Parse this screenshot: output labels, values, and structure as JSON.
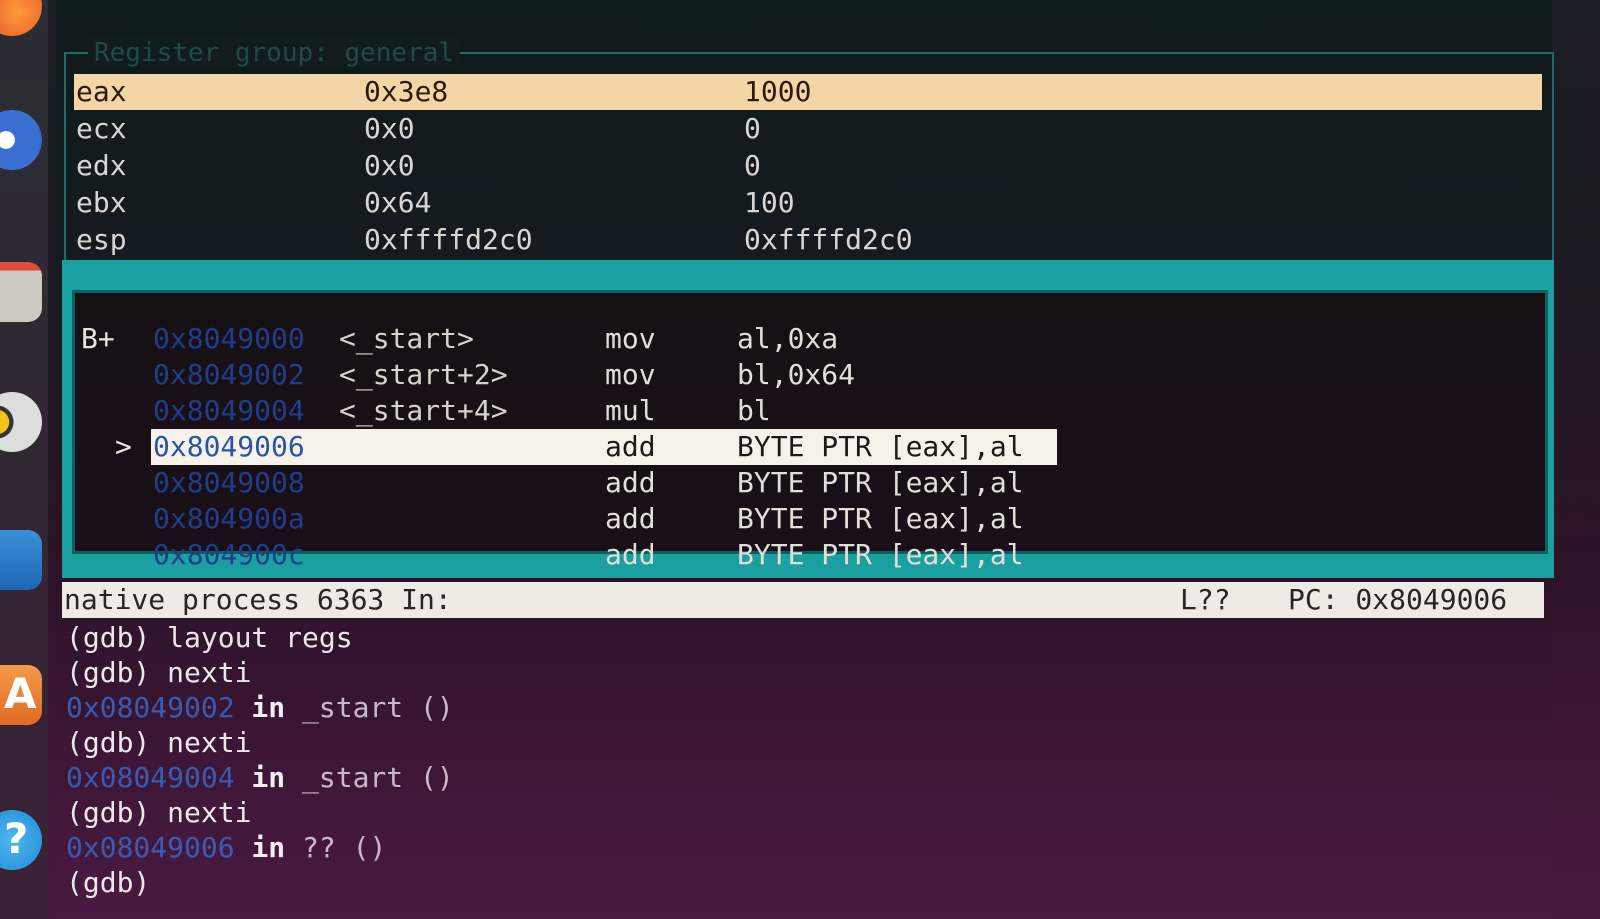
{
  "register_pane": {
    "title": "Register group: general",
    "rows": [
      {
        "name": "eax",
        "hex": "0x3e8",
        "natural": "1000",
        "highlighted": true
      },
      {
        "name": "ecx",
        "hex": "0x0",
        "natural": "0",
        "highlighted": false
      },
      {
        "name": "edx",
        "hex": "0x0",
        "natural": "0",
        "highlighted": false
      },
      {
        "name": "ebx",
        "hex": "0x64",
        "natural": "100",
        "highlighted": false
      },
      {
        "name": "esp",
        "hex": "0xffffd2c0",
        "natural": "0xffffd2c0",
        "highlighted": false
      }
    ]
  },
  "asm_pane": {
    "rows": [
      {
        "marker": "B+",
        "caret": "",
        "address": "0x8049000",
        "symbol": "<_start>",
        "opcode": "mov",
        "args": "al,0xa",
        "current": false
      },
      {
        "marker": "",
        "caret": "",
        "address": "0x8049002",
        "symbol": "<_start+2>",
        "opcode": "mov",
        "args": "bl,0x64",
        "current": false
      },
      {
        "marker": "",
        "caret": "",
        "address": "0x8049004",
        "symbol": "<_start+4>",
        "opcode": "mul",
        "args": "bl",
        "current": false
      },
      {
        "marker": "",
        "caret": ">",
        "address": "0x8049006",
        "symbol": "",
        "opcode": "add",
        "args": "BYTE PTR [eax],al",
        "current": true
      },
      {
        "marker": "",
        "caret": "",
        "address": "0x8049008",
        "symbol": "",
        "opcode": "add",
        "args": "BYTE PTR [eax],al",
        "current": false
      },
      {
        "marker": "",
        "caret": "",
        "address": "0x804900a",
        "symbol": "",
        "opcode": "add",
        "args": "BYTE PTR [eax],al",
        "current": false
      },
      {
        "marker": "",
        "caret": "",
        "address": "0x804900c",
        "symbol": "",
        "opcode": "add",
        "args": "BYTE PTR [eax],al",
        "current": false
      }
    ]
  },
  "status_bar": {
    "left": "native process 6363 In:",
    "line": "L??",
    "pc": "PC: 0x8049006"
  },
  "command_history": [
    {
      "type": "prompt",
      "text": "(gdb) layout regs"
    },
    {
      "type": "prompt",
      "text": "(gdb) nexti"
    },
    {
      "type": "location",
      "address": "0x08049002",
      "in_text": " in ",
      "function": "_start ()"
    },
    {
      "type": "prompt",
      "text": "(gdb) nexti"
    },
    {
      "type": "location",
      "address": "0x08049004",
      "in_text": " in ",
      "function": "_start ()"
    },
    {
      "type": "prompt",
      "text": "(gdb) nexti"
    },
    {
      "type": "location",
      "address": "0x08049006",
      "in_text": " in ",
      "function": "?? ()"
    },
    {
      "type": "prompt",
      "text": "(gdb)"
    }
  ],
  "launcher": {
    "icons": [
      "firefox-icon",
      "thunderbird-icon",
      "files-icon",
      "rhythmbox-icon",
      "writer-icon",
      "software-center-icon",
      "help-icon"
    ],
    "help_glyph": "?",
    "software_glyph": "A"
  }
}
